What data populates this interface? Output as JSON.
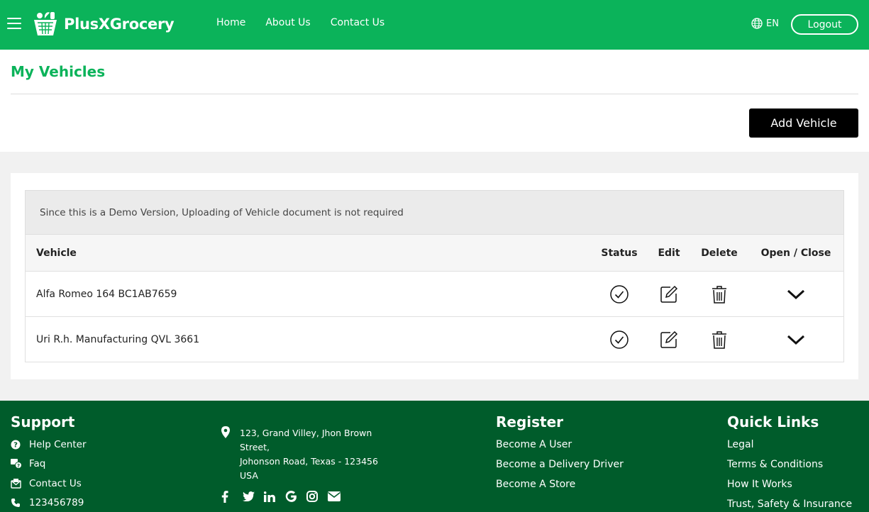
{
  "header": {
    "brand": "PlusXGrocery",
    "nav": [
      "Home",
      "About Us",
      "Contact Us"
    ],
    "language": "EN",
    "logout": "Logout"
  },
  "page": {
    "title": "My Vehicles",
    "add_button": "Add Vehicle"
  },
  "notice": "Since this is a Demo Version, Uploading of Vehicle document is not required",
  "table": {
    "columns": [
      "Vehicle",
      "Status",
      "Edit",
      "Delete",
      "Open / Close"
    ],
    "rows": [
      {
        "vehicle": "Alfa Romeo 164 BC1AB7659"
      },
      {
        "vehicle": "Uri R.h. Manufacturing QVL 3661"
      }
    ]
  },
  "footer": {
    "support": {
      "heading": "Support",
      "items": [
        "Help Center",
        "Faq",
        "Contact Us",
        "123456789"
      ]
    },
    "address": [
      "123, Grand Villey, Jhon Brown",
      "Street,",
      "Johonson Road, Texas - 123456",
      "USA"
    ],
    "register": {
      "heading": "Register",
      "links": [
        "Become A User",
        "Become a Delivery Driver",
        "Become A Store"
      ]
    },
    "quick_links": {
      "heading": "Quick Links",
      "links": [
        "Legal",
        "Terms & Conditions",
        "How It Works",
        "Trust, Safety & Insurance"
      ]
    },
    "social_icons": [
      "facebook-icon",
      "twitter-icon",
      "linkedin-icon",
      "google-icon",
      "instagram-icon",
      "email-icon"
    ]
  },
  "colors": {
    "brand_green": "#0bb35a",
    "footer_green": "#005c2b",
    "accent_title": "#0bb35a"
  }
}
